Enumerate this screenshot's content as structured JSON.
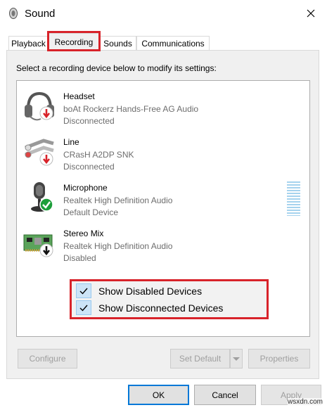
{
  "window": {
    "title": "Sound"
  },
  "tabs": [
    {
      "label": "Playback"
    },
    {
      "label": "Recording"
    },
    {
      "label": "Sounds"
    },
    {
      "label": "Communications"
    }
  ],
  "active_tab": "Recording",
  "instruction": "Select a recording device below to modify its settings:",
  "devices": [
    {
      "name": "Headset",
      "description": "boAt Rockerz Hands-Free AG Audio",
      "status": "Disconnected",
      "icon": "headset-icon",
      "badge": "red-down-arrow-badge"
    },
    {
      "name": "Line",
      "description": "CRasH A2DP SNK",
      "status": "Disconnected",
      "icon": "line-in-cable-icon",
      "badge": "red-down-arrow-badge"
    },
    {
      "name": "Microphone",
      "description": "Realtek High Definition Audio",
      "status": "Default Device",
      "icon": "microphone-icon",
      "badge": "green-check-badge"
    },
    {
      "name": "Stereo Mix",
      "description": "Realtek High Definition Audio",
      "status": "Disabled",
      "icon": "sound-card-icon",
      "badge": "black-down-arrow-badge"
    }
  ],
  "context_menu": {
    "items": [
      {
        "label": "Show Disabled Devices",
        "checked": true
      },
      {
        "label": "Show Disconnected Devices",
        "checked": true
      }
    ]
  },
  "buttons": {
    "configure": "Configure",
    "set_default": "Set Default",
    "properties": "Properties",
    "ok": "OK",
    "cancel": "Cancel",
    "apply": "Apply"
  },
  "watermark": "wsxdn.com",
  "colors": {
    "highlight_red": "#d8232a",
    "accent_blue": "#0078d7",
    "check_bg": "#cce4f7",
    "meter_blue": "#a6d3ee"
  }
}
